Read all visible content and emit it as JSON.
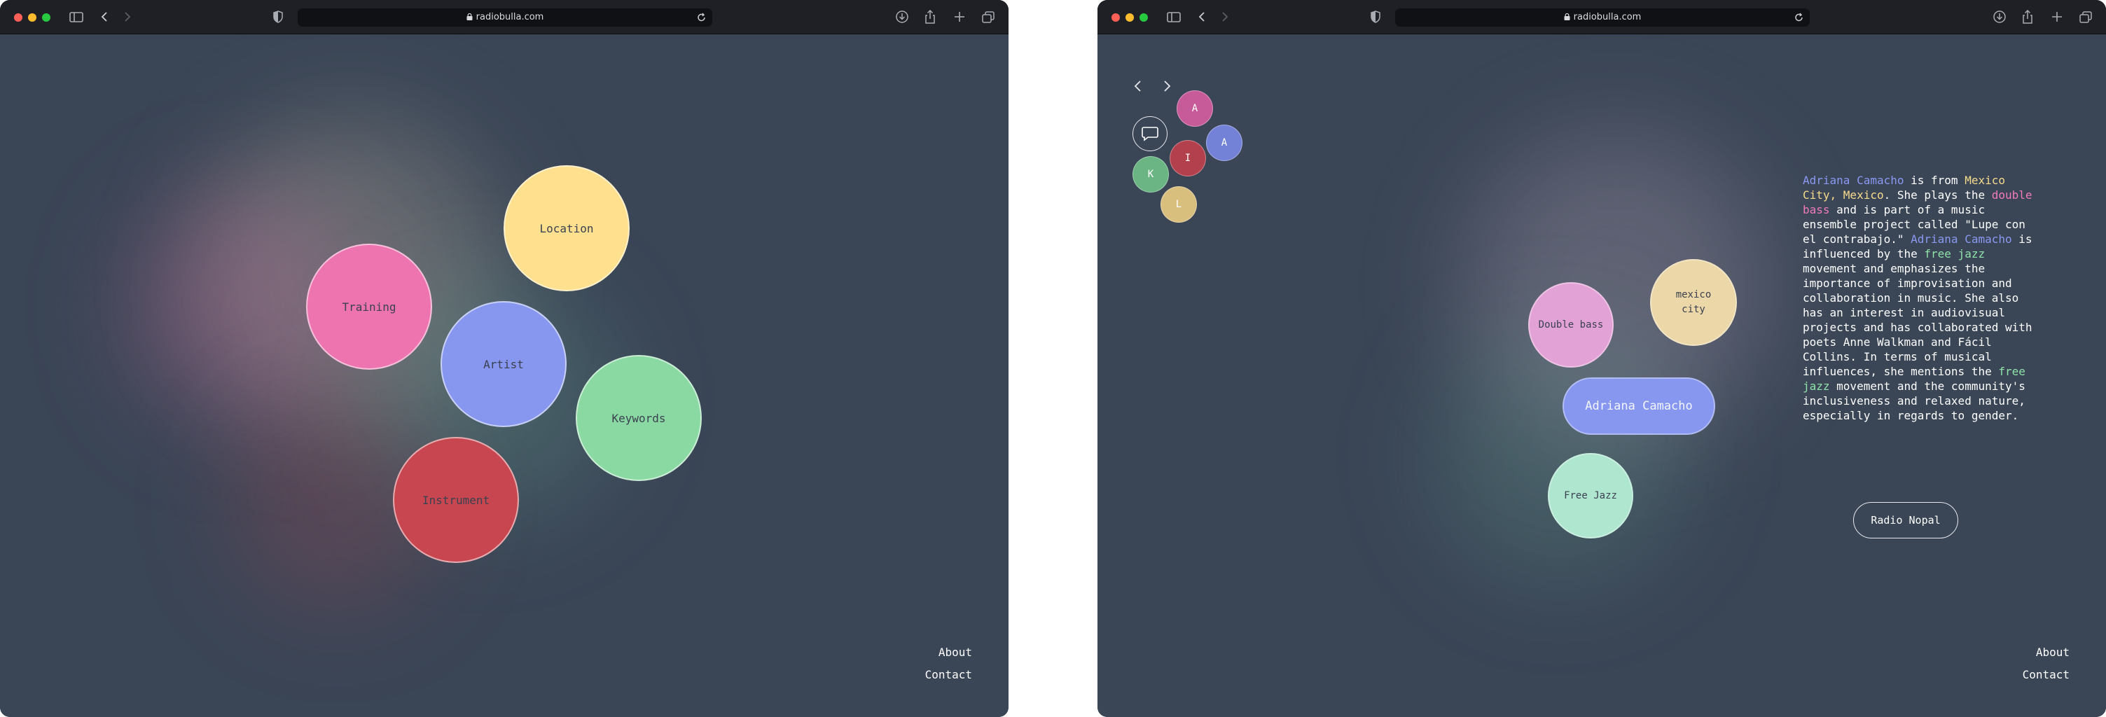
{
  "browser": {
    "url": "radiobulla.com"
  },
  "left_page": {
    "bubbles": {
      "location": "Location",
      "training": "Training",
      "artist": "Artist",
      "keywords": "Keywords",
      "instrument": "Instrument"
    },
    "footer": {
      "about": "About",
      "contact": "Contact"
    }
  },
  "right_page": {
    "nav": {
      "back": "<",
      "forward": ">"
    },
    "circles": [
      "A",
      "A",
      "I",
      "K",
      "L"
    ],
    "tags": {
      "double_bass": "Double bass",
      "mexico_city": "mexico city",
      "artist_name": "Adriana Camacho",
      "free_jazz": "Free Jazz"
    },
    "bio": {
      "p1_name": "Adriana Camacho",
      "p1_a": " is from ",
      "p1_place": "Mexico City, Mexico",
      "p1_b": ". She plays the ",
      "p1_inst": "double bass",
      "p1_c": " and is part of a music ensemble project called \"Lupe con el contrabajo.\" ",
      "p2_name": "Adriana Camacho",
      "p2_a": " is influenced by the ",
      "p2_genre": "free jazz",
      "p2_b": " movement and emphasizes the importance of improvisation and collaboration in music. She also has an interest in audiovisual projects and has collaborated with poets Anne Walkman and Fácil Collins. In terms of musical influences, she mentions the ",
      "p2_genre2": "free jazz",
      "p2_c": " movement and the community's inclusiveness and relaxed nature, especially in regards to gender."
    },
    "radio_button": "Radio Nopal",
    "footer": {
      "about": "About",
      "contact": "Contact"
    }
  },
  "colors": {
    "background": "#3a4556",
    "location": "#fee08e",
    "training": "#ee74b0",
    "artist": "#8797ef",
    "keywords": "#8ad9a2",
    "instrument": "#c8464f"
  }
}
